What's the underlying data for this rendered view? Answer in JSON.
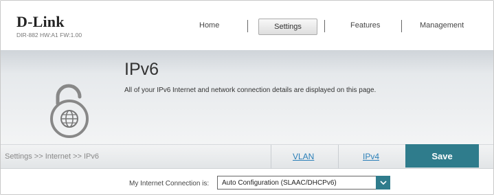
{
  "header": {
    "logo": "D-Link",
    "model_info": "DIR-882 HW:A1 FW:1.00",
    "nav": {
      "home": "Home",
      "settings": "Settings",
      "features": "Features",
      "management": "Management"
    }
  },
  "hero": {
    "title": "IPv6",
    "description": "All of your IPv6 Internet and network connection details are displayed on this page.",
    "icon": "globe-lock-icon"
  },
  "action_bar": {
    "breadcrumb": "Settings >> Internet >> IPv6",
    "vlan_label": "VLAN",
    "ipv4_label": "IPv4",
    "save_label": "Save"
  },
  "form": {
    "connection_label": "My Internet Connection is:",
    "connection_value": "Auto Configuration (SLAAC/DHCPv6)"
  },
  "colors": {
    "accent": "#2f7c8c",
    "link": "#2a7fb8"
  }
}
